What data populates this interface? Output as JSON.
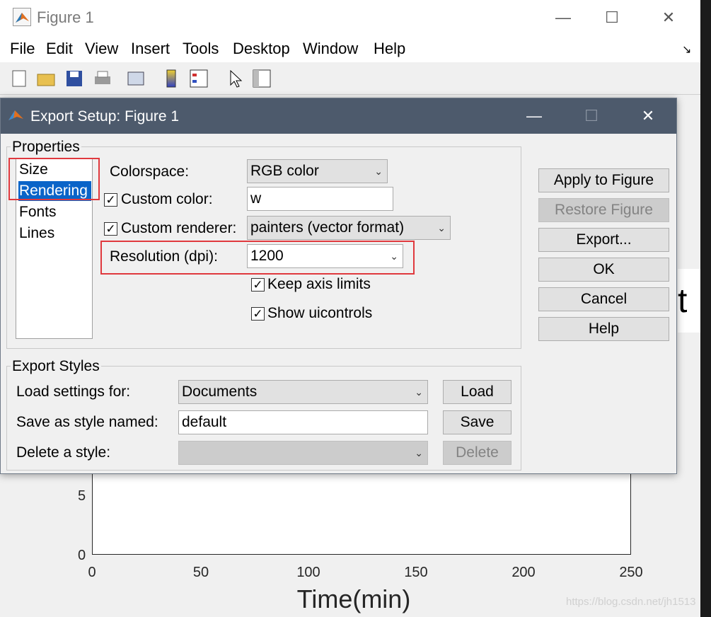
{
  "figure": {
    "title": "Figure 1",
    "menu": [
      "File",
      "Edit",
      "View",
      "Insert",
      "Tools",
      "Desktop",
      "Window",
      "Help"
    ],
    "toolbar_icons": [
      "new-file-icon",
      "open-folder-icon",
      "save-icon",
      "print-icon",
      "print-preview-icon",
      "colorbar-icon",
      "legend-icon",
      "pointer-icon",
      "property-editor-icon"
    ],
    "window_controls": {
      "minimize": "—",
      "maximize": "☐",
      "close": "✕"
    },
    "dock_glyph": "↘"
  },
  "dialog": {
    "title": "Export Setup: Figure 1",
    "window_controls": {
      "minimize": "—",
      "maximize": "☐",
      "close": "✕"
    },
    "properties": {
      "group_label": "Properties",
      "list": [
        "Size",
        "Rendering",
        "Fonts",
        "Lines"
      ],
      "selected": "Rendering",
      "colorspace_label": "Colorspace:",
      "colorspace_value": "RGB color",
      "custom_color_label": "Custom color:",
      "custom_color_checked": true,
      "custom_color_value": "w",
      "custom_renderer_label": "Custom renderer:",
      "custom_renderer_checked": true,
      "custom_renderer_value": "painters (vector format)",
      "resolution_label": "Resolution (dpi):",
      "resolution_value": "1200",
      "keep_axis_label": "Keep axis limits",
      "keep_axis_checked": true,
      "show_uicontrols_label": "Show uicontrols",
      "show_uicontrols_checked": true,
      "check_glyph": "✓",
      "arrow_glyph": "⌄"
    },
    "side_buttons": {
      "apply": "Apply to Figure",
      "restore": "Restore Figure",
      "export": "Export...",
      "ok": "OK",
      "cancel": "Cancel",
      "help": "Help"
    },
    "export_styles": {
      "group_label": "Export Styles",
      "load_label": "Load settings for:",
      "load_value": "Documents",
      "load_button": "Load",
      "save_label": "Save as style named:",
      "save_value": "default",
      "save_button": "Save",
      "delete_label": "Delete a style:",
      "delete_value": "",
      "delete_button": "Delete"
    }
  },
  "chart_data": {
    "type": "line",
    "xlabel": "Time(min)",
    "ylabel": "",
    "x_ticks": [
      "0",
      "50",
      "100",
      "150",
      "200",
      "250"
    ],
    "y_ticks_visible": [
      "5",
      "0"
    ],
    "xlim": [
      0,
      250
    ],
    "series": []
  },
  "background": {
    "right_edge_letter": "t",
    "watermark": "https://blog.csdn.net/jh1513"
  }
}
